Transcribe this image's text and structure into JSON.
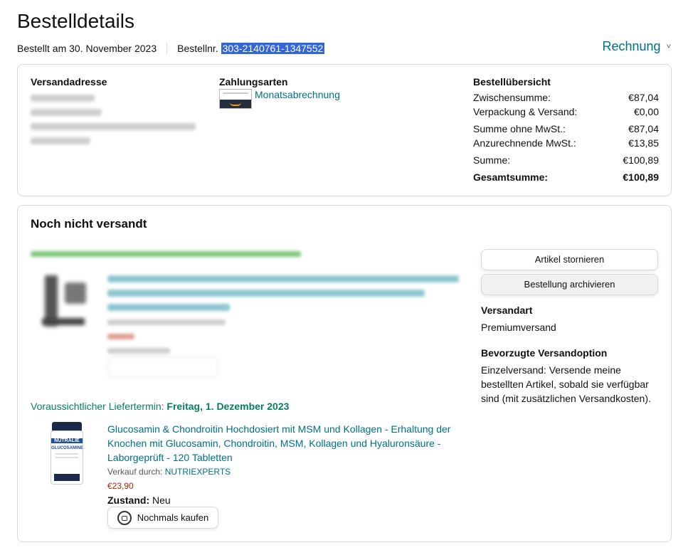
{
  "header": {
    "title": "Bestelldetails",
    "ordered_on": "Bestellt am 30. November 2023",
    "order_number_label": "Bestellnr.",
    "order_number": "303-2140761-1347552",
    "invoice_label": "Rechnung",
    "invoice_chevron": "˅"
  },
  "summary_box": {
    "shipping_address_label": "Versandadresse",
    "payment_label": "Zahlungsarten",
    "payment_method": "Monatsabrechnung",
    "overview_label": "Bestellübersicht",
    "rows": [
      {
        "label": "Zwischensumme:",
        "value": "€87,04"
      },
      {
        "label": "Verpackung & Versand:",
        "value": "€0,00"
      },
      {
        "label": "Summe ohne MwSt.:",
        "value": "€87,04"
      },
      {
        "label": "Anzurechnende MwSt.:",
        "value": "€13,85"
      },
      {
        "label": "Summe:",
        "value": "€100,89"
      },
      {
        "label": "Gesamtsumme:",
        "value": "€100,89"
      }
    ]
  },
  "shipment": {
    "title": "Noch nicht versandt",
    "cancel_label": "Artikel stornieren",
    "archive_label": "Bestellung archivieren",
    "shipping_type_label": "Versandart",
    "shipping_type": "Premiumversand",
    "preferred_label": "Bevorzugte Versandoption",
    "preferred_text": "Einzelversand: Versende meine bestellten Artikel, sobald sie verfügbar sind (mit zusätzlichen Versandkosten).",
    "item2": {
      "delivery_prefix": "Voraussichtlicher Liefertermin: ",
      "delivery_date": "Freitag, 1. Dezember 2023",
      "title": "Glucosamin & Chondroitin Hochdosiert mit MSM und Kollagen - Erhaltung der Knochen mit Glucosamin, Chondroitin, MSM, Kollagen und Hyaluronsäure - Laborgeprüft - 120 Tabletten",
      "seller_label": "Verkauf durch: ",
      "seller": "NUTRIEXPERTS",
      "price": "€23,90",
      "condition_label": "Zustand:",
      "condition": "Neu",
      "buy_again": "Nochmals kaufen",
      "bottle_brand": "NUTRALIE",
      "bottle_name": "GLUCOSAMINE"
    }
  }
}
